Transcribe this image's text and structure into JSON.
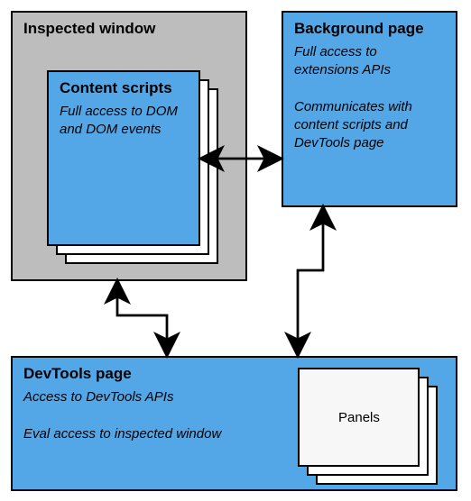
{
  "inspected_window": {
    "title": "Inspected window"
  },
  "content_scripts": {
    "title": "Content scripts",
    "body": "Full access to DOM and DOM events"
  },
  "background_page": {
    "title": "Background page",
    "body": "Full access to extensions APIs\n\nCommunicates with content scripts and DevTools page"
  },
  "devtools_page": {
    "title": "DevTools page",
    "body": "Access to DevTools APIs\n\nEval access to inspected window"
  },
  "panels": {
    "label": "Panels"
  },
  "colors": {
    "blue": "#54a7e6",
    "gray": "#bdbdbd",
    "outline": "#000000"
  }
}
